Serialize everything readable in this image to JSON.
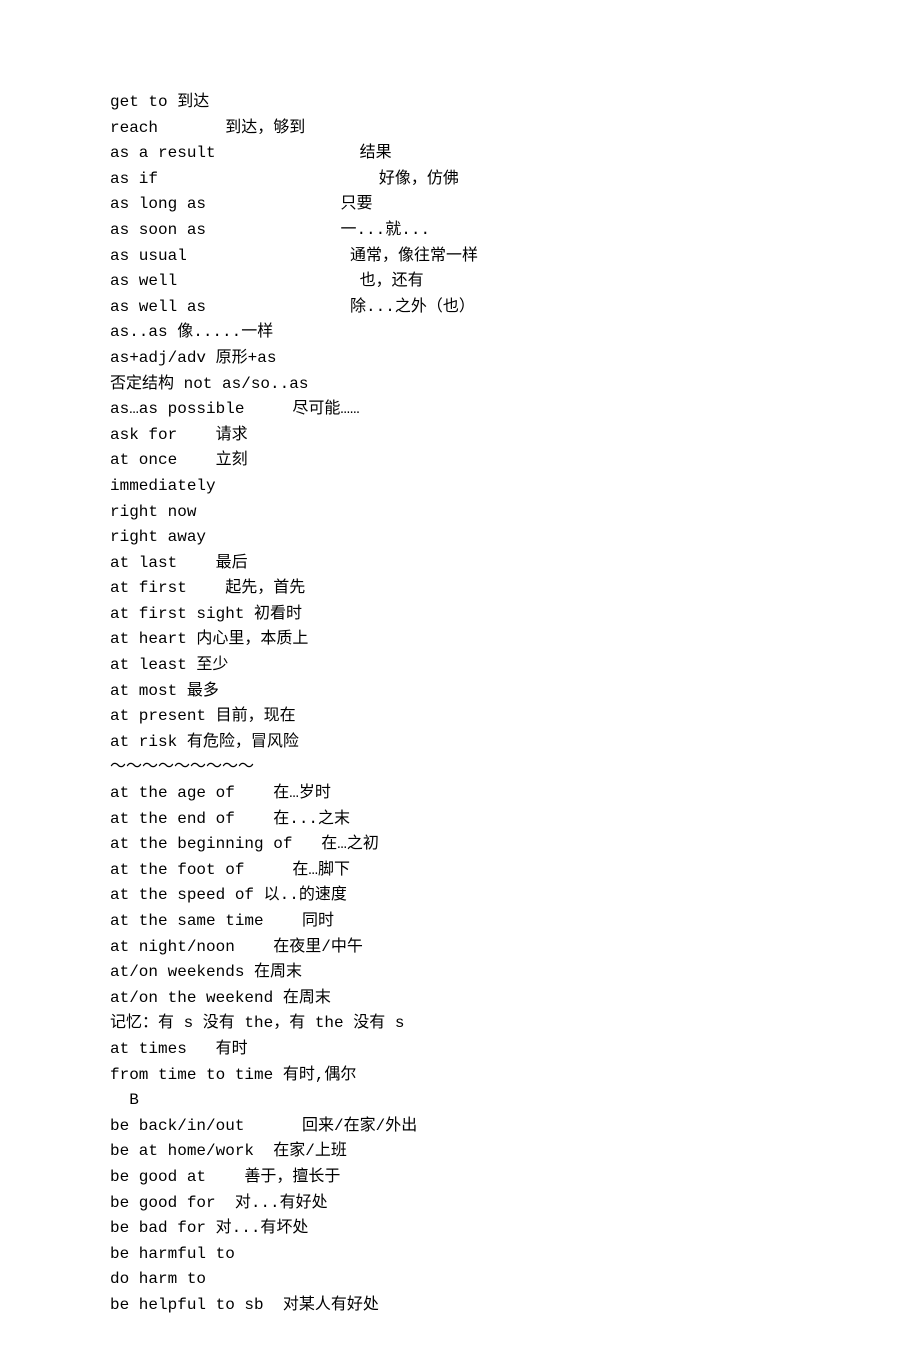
{
  "lines": [
    "get to 到达",
    "reach       到达，够到",
    "as a result               结果",
    "as if                       好像，仿佛",
    "as long as              只要",
    "as soon as              一...就...",
    "as usual                 通常，像往常一样",
    "as well                   也，还有",
    "as well as               除...之外（也）",
    "as..as 像.....一样",
    "as+adj/adv 原形+as",
    "否定结构 not as/so..as",
    "as…as possible     尽可能……",
    "ask for    请求",
    "at once    立刻",
    "immediately",
    "right now",
    "right away",
    "at last    最后",
    "at first    起先，首先",
    "at first sight 初看时",
    "at heart 内心里，本质上",
    "at least 至少",
    "at most 最多",
    "at present 目前，现在",
    "at risk 有危险，冒风险",
    "～～～～～～～～～",
    "at the age of    在…岁时",
    "at the end of    在...之末",
    "at the beginning of   在…之初",
    "at the foot of     在…脚下",
    "at the speed of 以..的速度",
    "at the same time    同时",
    "at night/noon    在夜里/中午",
    "at/on weekends 在周末",
    "at/on the weekend 在周末",
    "记忆：有 s 没有 the，有 the 没有 s",
    "at times   有时",
    "from time to time 有时,偶尔",
    "  B",
    "be back/in/out      回来/在家/外出",
    "be at home/work  在家/上班",
    "be good at    善于，擅长于",
    "be good for  对...有好处",
    "be bad for 对...有坏处",
    "be harmful to",
    "do harm to",
    "be helpful to sb  对某人有好处"
  ]
}
